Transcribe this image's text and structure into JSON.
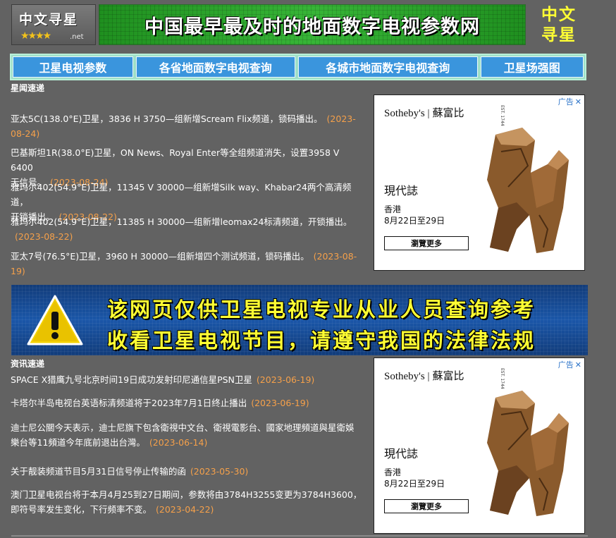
{
  "header": {
    "logo_text": "中文寻星",
    "logo_stars": "★★★★",
    "logo_domain": ".net",
    "banner_text": "中国最早最及时的地面数字电视参数网",
    "brand_line1": "中文",
    "brand_line2": "寻星"
  },
  "nav": [
    {
      "label": "卫星电视参数"
    },
    {
      "label": "各省地面数字电视查询"
    },
    {
      "label": "各城市地面数字电视查询"
    },
    {
      "label": "卫星场强图"
    }
  ],
  "star_news": {
    "heading": "星闻速递",
    "items": [
      {
        "line1": "亚太5C(138.0°E)卫星，3836 H 3750—组新增Scream Flix频道，锁码播出。",
        "line2": "",
        "date1": "(2023-",
        "date2": "08-24)"
      },
      {
        "line1": "巴基斯坦1R(38.0°E)卫星，ON News、Royal Enter等全组频道消失，设置3958 V 6400",
        "line2": "无信号。",
        "date1": "",
        "date2": "(2023-08-24)"
      },
      {
        "line1": "雅玛尔402(54.9°E)卫星，11345 V 30000—组新增Silk way、Khabar24两个高清频道，",
        "line2": "开锁播出。",
        "date1": "",
        "date2": "(2023-08-22)"
      },
      {
        "line1": "雅玛尔402(54.9°E)卫星，11385 H 30000—组新增leomax24标清频道，开锁播出。",
        "line2": "",
        "date1": "",
        "date2": "(2023-08-22)"
      },
      {
        "line1": "亚太7号(76.5°E)卫星，3960 H 30000—组新增四个测试频道，锁码播出。",
        "line2": "",
        "date1": "(2023-08-",
        "date2": "19)"
      }
    ]
  },
  "ads": {
    "tag": "广告",
    "brand_en": "Sotheby's",
    "brand_sep": "|",
    "brand_cn": "蘇富比",
    "brand_est": "EST. 1744",
    "title": "現代誌",
    "location": "香港",
    "dates": "8月22日至29日",
    "cta": "瀏覽更多"
  },
  "warning": {
    "line1": "该网页仅供卫星电视专业从业人员查询参考",
    "line2": "收看卫星电视节目，请遵守我国的法律法规"
  },
  "info_news": {
    "heading": "资讯速递",
    "items": [
      {
        "line1": "SPACE X猎鹰九号北京时间19日成功发射印尼通信星PSN卫星",
        "line2": "",
        "date": "(2023-06-19)"
      },
      {
        "line1": "卡塔尔半岛电视台英语标清频道将于2023年7月1日终止播出",
        "line2": "",
        "date": "(2023-06-19)"
      },
      {
        "line1": "迪士尼公關今天表示，迪士尼旗下包含衛視中文台、衛視電影台、國家地理頻道與星衛娛",
        "line2": "樂台等11頻道今年底前退出台灣。",
        "date": "(2023-06-14)"
      },
      {
        "line1": "关于靓装频道节目5月31日信号停止传输的函",
        "line2": "",
        "date": "(2023-05-30)"
      },
      {
        "line1": "澳门卫星电视台将于本月4月25到27日期间，参数将由3784H3255变更为3784H3600，",
        "line2": "即符号率发生变化，下行频率不变。",
        "date": "(2023-04-22)"
      }
    ]
  }
}
